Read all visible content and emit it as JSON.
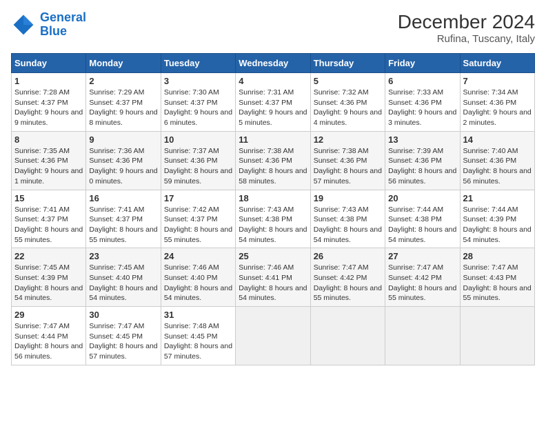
{
  "header": {
    "logo_line1": "General",
    "logo_line2": "Blue",
    "title": "December 2024",
    "subtitle": "Rufina, Tuscany, Italy"
  },
  "weekdays": [
    "Sunday",
    "Monday",
    "Tuesday",
    "Wednesday",
    "Thursday",
    "Friday",
    "Saturday"
  ],
  "weeks": [
    [
      {
        "day": "1",
        "info": "Sunrise: 7:28 AM\nSunset: 4:37 PM\nDaylight: 9 hours and 9 minutes."
      },
      {
        "day": "2",
        "info": "Sunrise: 7:29 AM\nSunset: 4:37 PM\nDaylight: 9 hours and 8 minutes."
      },
      {
        "day": "3",
        "info": "Sunrise: 7:30 AM\nSunset: 4:37 PM\nDaylight: 9 hours and 6 minutes."
      },
      {
        "day": "4",
        "info": "Sunrise: 7:31 AM\nSunset: 4:37 PM\nDaylight: 9 hours and 5 minutes."
      },
      {
        "day": "5",
        "info": "Sunrise: 7:32 AM\nSunset: 4:36 PM\nDaylight: 9 hours and 4 minutes."
      },
      {
        "day": "6",
        "info": "Sunrise: 7:33 AM\nSunset: 4:36 PM\nDaylight: 9 hours and 3 minutes."
      },
      {
        "day": "7",
        "info": "Sunrise: 7:34 AM\nSunset: 4:36 PM\nDaylight: 9 hours and 2 minutes."
      }
    ],
    [
      {
        "day": "8",
        "info": "Sunrise: 7:35 AM\nSunset: 4:36 PM\nDaylight: 9 hours and 1 minute."
      },
      {
        "day": "9",
        "info": "Sunrise: 7:36 AM\nSunset: 4:36 PM\nDaylight: 9 hours and 0 minutes."
      },
      {
        "day": "10",
        "info": "Sunrise: 7:37 AM\nSunset: 4:36 PM\nDaylight: 8 hours and 59 minutes."
      },
      {
        "day": "11",
        "info": "Sunrise: 7:38 AM\nSunset: 4:36 PM\nDaylight: 8 hours and 58 minutes."
      },
      {
        "day": "12",
        "info": "Sunrise: 7:38 AM\nSunset: 4:36 PM\nDaylight: 8 hours and 57 minutes."
      },
      {
        "day": "13",
        "info": "Sunrise: 7:39 AM\nSunset: 4:36 PM\nDaylight: 8 hours and 56 minutes."
      },
      {
        "day": "14",
        "info": "Sunrise: 7:40 AM\nSunset: 4:36 PM\nDaylight: 8 hours and 56 minutes."
      }
    ],
    [
      {
        "day": "15",
        "info": "Sunrise: 7:41 AM\nSunset: 4:37 PM\nDaylight: 8 hours and 55 minutes."
      },
      {
        "day": "16",
        "info": "Sunrise: 7:41 AM\nSunset: 4:37 PM\nDaylight: 8 hours and 55 minutes."
      },
      {
        "day": "17",
        "info": "Sunrise: 7:42 AM\nSunset: 4:37 PM\nDaylight: 8 hours and 55 minutes."
      },
      {
        "day": "18",
        "info": "Sunrise: 7:43 AM\nSunset: 4:38 PM\nDaylight: 8 hours and 54 minutes."
      },
      {
        "day": "19",
        "info": "Sunrise: 7:43 AM\nSunset: 4:38 PM\nDaylight: 8 hours and 54 minutes."
      },
      {
        "day": "20",
        "info": "Sunrise: 7:44 AM\nSunset: 4:38 PM\nDaylight: 8 hours and 54 minutes."
      },
      {
        "day": "21",
        "info": "Sunrise: 7:44 AM\nSunset: 4:39 PM\nDaylight: 8 hours and 54 minutes."
      }
    ],
    [
      {
        "day": "22",
        "info": "Sunrise: 7:45 AM\nSunset: 4:39 PM\nDaylight: 8 hours and 54 minutes."
      },
      {
        "day": "23",
        "info": "Sunrise: 7:45 AM\nSunset: 4:40 PM\nDaylight: 8 hours and 54 minutes."
      },
      {
        "day": "24",
        "info": "Sunrise: 7:46 AM\nSunset: 4:40 PM\nDaylight: 8 hours and 54 minutes."
      },
      {
        "day": "25",
        "info": "Sunrise: 7:46 AM\nSunset: 4:41 PM\nDaylight: 8 hours and 54 minutes."
      },
      {
        "day": "26",
        "info": "Sunrise: 7:47 AM\nSunset: 4:42 PM\nDaylight: 8 hours and 55 minutes."
      },
      {
        "day": "27",
        "info": "Sunrise: 7:47 AM\nSunset: 4:42 PM\nDaylight: 8 hours and 55 minutes."
      },
      {
        "day": "28",
        "info": "Sunrise: 7:47 AM\nSunset: 4:43 PM\nDaylight: 8 hours and 55 minutes."
      }
    ],
    [
      {
        "day": "29",
        "info": "Sunrise: 7:47 AM\nSunset: 4:44 PM\nDaylight: 8 hours and 56 minutes."
      },
      {
        "day": "30",
        "info": "Sunrise: 7:47 AM\nSunset: 4:45 PM\nDaylight: 8 hours and 57 minutes."
      },
      {
        "day": "31",
        "info": "Sunrise: 7:48 AM\nSunset: 4:45 PM\nDaylight: 8 hours and 57 minutes."
      },
      null,
      null,
      null,
      null
    ]
  ]
}
